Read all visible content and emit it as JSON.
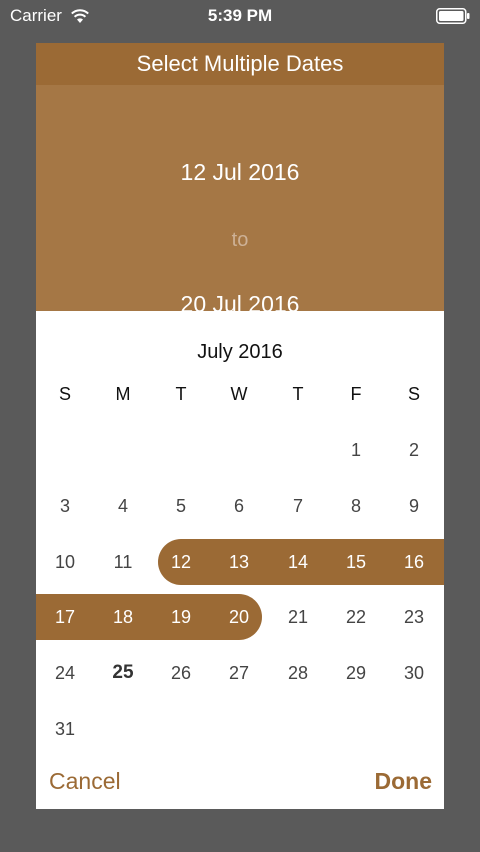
{
  "status_bar": {
    "carrier": "Carrier",
    "time": "5:39 PM"
  },
  "dialog": {
    "title": "Select Multiple Dates",
    "start_date": "12 Jul 2016",
    "separator": "to",
    "end_date": "20 Jul 2016",
    "month_title": "July 2016",
    "weekdays": [
      "S",
      "M",
      "T",
      "W",
      "T",
      "F",
      "S"
    ],
    "weeks": [
      [
        "",
        "",
        "",
        "",
        "",
        "1",
        "2"
      ],
      [
        "3",
        "4",
        "5",
        "6",
        "7",
        "8",
        "9"
      ],
      [
        "10",
        "11",
        "12",
        "13",
        "14",
        "15",
        "16"
      ],
      [
        "17",
        "18",
        "19",
        "20",
        "21",
        "22",
        "23"
      ],
      [
        "24",
        "25",
        "26",
        "27",
        "28",
        "29",
        "30"
      ],
      [
        "31",
        "",
        "",
        "",
        "",
        "",
        ""
      ]
    ],
    "selected_start_day": 12,
    "selected_end_day": 20,
    "today_day": 25,
    "cancel_label": "Cancel",
    "done_label": "Done"
  },
  "colors": {
    "accent": "#9b6a35",
    "range_panel": "#a57745",
    "overlay": "#5a5a5a"
  }
}
